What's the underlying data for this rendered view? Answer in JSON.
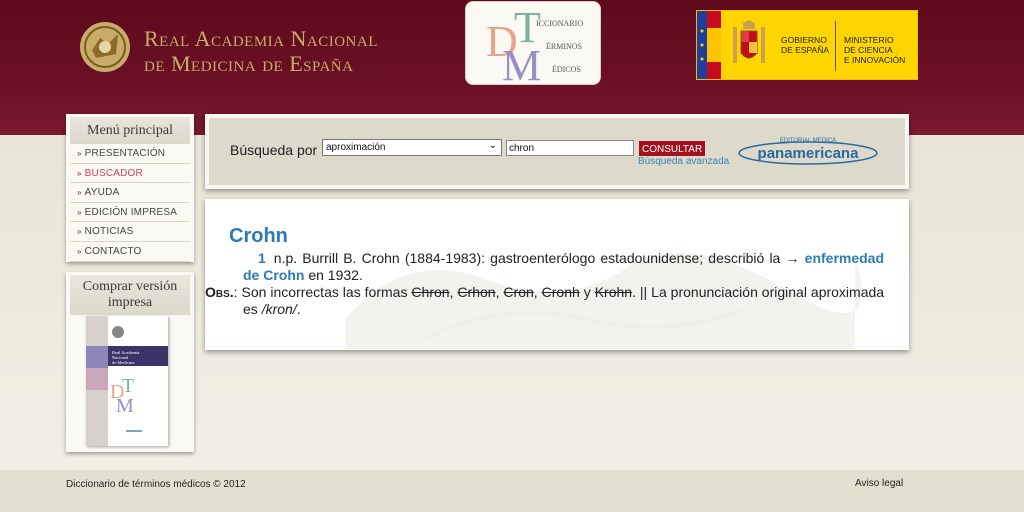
{
  "header": {
    "academy_title_line1": "Real Academia Nacional",
    "academy_title_line2": "de Medicina de España",
    "dtm_logo": {
      "letters": "DTM",
      "word1": "ICCIONARIO",
      "word2": "ÉRMINOS",
      "word3": "ÉDICOS"
    },
    "gobierno": {
      "line1": "GOBIERNO",
      "line2": "DE ESPAÑA",
      "ministry_line1": "MINISTERIO",
      "ministry_line2": "DE CIENCIA",
      "ministry_line3": "E INNOVACIÓN"
    }
  },
  "sidebar": {
    "menu_title": "Menú principal",
    "items": [
      {
        "label": "Presentación",
        "active": false
      },
      {
        "label": "Buscador",
        "active": true
      },
      {
        "label": "Ayuda",
        "active": false
      },
      {
        "label": "Edición impresa",
        "active": false
      },
      {
        "label": "Noticias",
        "active": false
      },
      {
        "label": "Contacto",
        "active": false
      }
    ],
    "buy_title": "Comprar versión impresa",
    "book_title_line1": "Real Academia",
    "book_title_line2": "Nacional",
    "book_title_line3": "de Medicina"
  },
  "search": {
    "label": "Búsqueda por",
    "mode_selected": "aproximación",
    "query": "chron",
    "submit_label": "CONSULTAR",
    "advanced_link": "Búsqueda avanzada",
    "sponsor_top": "EDITORIAL MEDICA",
    "sponsor_name": "panamericana"
  },
  "result": {
    "headword": "Crohn",
    "sense_number": "1",
    "definition_before": "n.p. Burrill B. Crohn (1884-1983): gastroenterólogo estadounidense; describió la →",
    "xref": "enfermedad de Crohn",
    "definition_after": "en 1932.",
    "obs_label": "Obs.",
    "obs_intro": ": Son incorrectas las formas",
    "incorrect_forms": [
      "Chron",
      "Crhon",
      "Cron",
      "Cronh",
      "Krohn"
    ],
    "sep_comma": ",",
    "sep_y": "y",
    "obs_tail": ". || La pronunciación original aproximada es",
    "pronunciation": "/kron/",
    "final_period": "."
  },
  "footer": {
    "copyright": "Diccionario de términos médicos © 2012",
    "legal_link": "Aviso legal"
  },
  "colors": {
    "header_bg": "#5e0a1c",
    "gold_text": "#c9ab6a",
    "accent_blue": "#2d7bb0",
    "button_red": "#a3111f",
    "gov_yellow": "#ffd400"
  }
}
